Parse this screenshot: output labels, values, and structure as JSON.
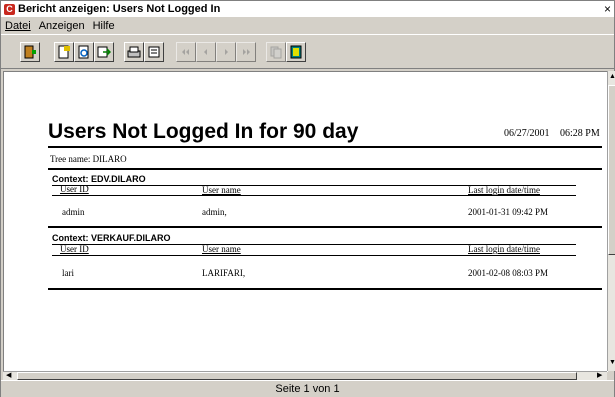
{
  "window": {
    "title": "Bericht anzeigen: Users Not Logged In",
    "close_glyph": "×"
  },
  "menu": {
    "items": [
      "Datei",
      "Anzeigen",
      "Hilfe"
    ]
  },
  "toolbar": {
    "buttons": [
      "exit-icon",
      "open-report-icon",
      "refresh-icon",
      "export-icon",
      "print-icon",
      "print-preview-icon",
      "first-page-icon",
      "previous-page-icon",
      "next-page-icon",
      "last-page-icon",
      "copy-icon",
      "help-icon"
    ]
  },
  "report": {
    "title": "Users Not Logged In for 90 day",
    "date": "06/27/2001",
    "time": "06:28 PM",
    "tree_label": "Tree name: DILARO",
    "columns": {
      "user_id": "User ID",
      "user_name": "User name",
      "last_login": "Last login date/time"
    },
    "contexts": [
      {
        "label": "Context: EDV.DILARO",
        "rows": [
          {
            "user_id": "admin",
            "user_name": "admin,",
            "last_login": "2001-01-31 09:42 PM"
          }
        ]
      },
      {
        "label": "Context: VERKAUF.DILARO",
        "rows": [
          {
            "user_id": "lari",
            "user_name": "LARIFARI,",
            "last_login": "2001-02-08 08:03 PM"
          }
        ]
      }
    ]
  },
  "status": {
    "page_text": "Seite 1 von 1"
  },
  "colors": {
    "title_icon": "#c8281e",
    "window_bg": "#d4d0c8",
    "content_bg": "#ffffff"
  }
}
